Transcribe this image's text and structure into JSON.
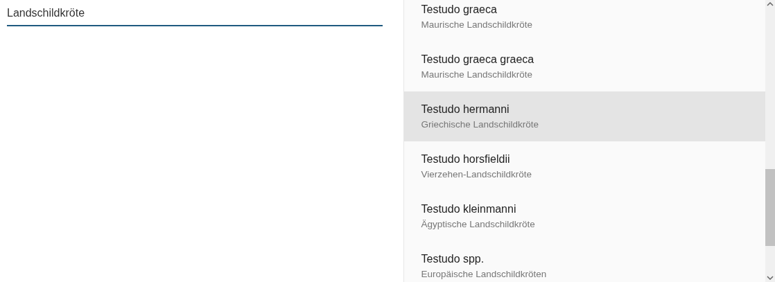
{
  "search": {
    "value": "Landschildkröte"
  },
  "results": [
    {
      "name": "Testudo graeca",
      "common": "Maurische Landschildkröte",
      "selected": false
    },
    {
      "name": "Testudo graeca graeca",
      "common": "Maurische Landschildkröte",
      "selected": false
    },
    {
      "name": "Testudo hermanni",
      "common": "Griechische Landschildkröte",
      "selected": true
    },
    {
      "name": "Testudo horsfieldii",
      "common": "Vierzehen-Landschildkröte",
      "selected": false
    },
    {
      "name": "Testudo kleinmanni",
      "common": "Ägyptische Landschildkröte",
      "selected": false
    },
    {
      "name": "Testudo spp.",
      "common": "Europäische Landschildkröten",
      "selected": false
    }
  ]
}
